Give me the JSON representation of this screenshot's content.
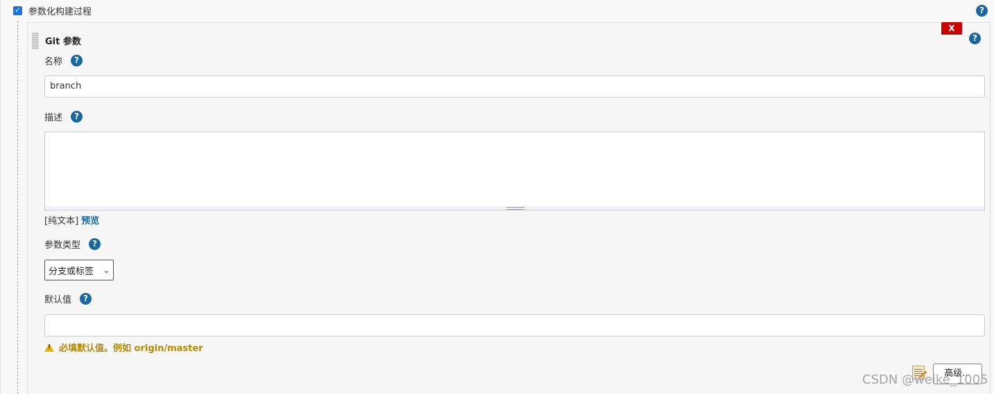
{
  "build_params": {
    "checkbox_checked": true,
    "label": "参数化构建过程",
    "help_icon": "help-icon"
  },
  "parameter": {
    "title": "Git 参数",
    "delete_label": "X",
    "name": {
      "label": "名称",
      "value": "branch"
    },
    "description": {
      "label": "描述",
      "value": "",
      "format_label": "[纯文本]",
      "preview_link": "预览"
    },
    "param_type": {
      "label": "参数类型",
      "selected": "分支或标签"
    },
    "default_value": {
      "label": "默认值",
      "value": "",
      "warning": "必填默认值。例如 origin/master"
    },
    "advanced_label": "高级..."
  },
  "watermark": "CSDN @weike_1005",
  "colors": {
    "help": "#1767a3",
    "delete": "#cc0000",
    "warning": "#b58a00",
    "checkbox": "#1a73e8"
  }
}
